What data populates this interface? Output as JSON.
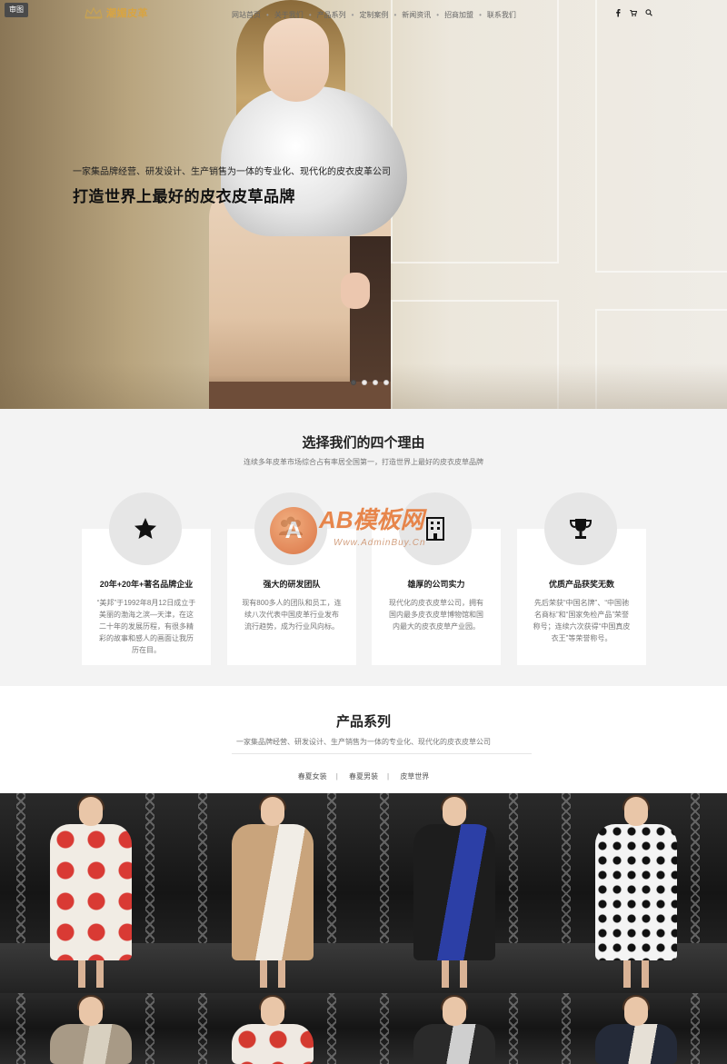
{
  "nav": {
    "home_badge": "审图",
    "logo_text": "潮媚皮革",
    "menu": [
      "网站首页",
      "关于我们",
      "产品系列",
      "定制案例",
      "新闻资讯",
      "招商加盟",
      "联系我们"
    ],
    "icons": [
      "facebook-icon",
      "cart-icon",
      "search-icon"
    ]
  },
  "hero": {
    "subtitle": "一家集品牌经营、研发设计、生产销售为一体的专业化、现代化的皮衣皮革公司",
    "title": "打造世界上最好的皮衣皮草品牌",
    "slides": 4,
    "active_slide": 1
  },
  "reasons": {
    "title": "选择我们的四个理由",
    "subtitle": "连续多年皮革市场综合占有率居全国第一，打造世界上最好的皮衣皮草品牌",
    "cards": [
      {
        "icon": "star-icon",
        "title": "20年+20年+著名品牌企业",
        "text": "“美邦”于1992年8月12日成立于美丽的渤海之滨—天津，在这二十年的发展历程，有很多精彩的故事和感人的画面让我历历在目。"
      },
      {
        "icon": "team-icon",
        "title": "强大的研发团队",
        "text": "现有800多人的团队和员工，连续八次代表中国皮革行业发布流行趋势，成为行业风向标。"
      },
      {
        "icon": "building-icon",
        "title": "雄厚的公司实力",
        "text": "现代化的皮衣皮草公司，拥有国内最多皮衣皮草博物馆和国内最大的皮衣皮草产业园。"
      },
      {
        "icon": "trophy-icon",
        "title": "优质产品获奖无数",
        "text": "先后荣获“中国名牌”、“中国驰名商标”和“国家免检产品”荣誉称号；连续六次获得“中国真皮衣王”等荣誉称号。"
      }
    ]
  },
  "watermark": {
    "letter": "A",
    "title": "AB模板网",
    "url": "Www.AdminBuy.Cn"
  },
  "products": {
    "title": "产品系列",
    "subtitle": "一家集品牌经营、研发设计、生产销售为一体的专业化、现代化的皮衣皮草公司",
    "tabs": [
      "春夏女装",
      "春夏男装",
      "皮草世界"
    ],
    "tiles": [
      {
        "garment": "red-polka-coat",
        "color": "#f1ece4",
        "accent": "#d93a34"
      },
      {
        "garment": "camel-coat-fur",
        "color": "#c9a47c",
        "accent": "#f1ede6"
      },
      {
        "garment": "black-coat-blue-fur",
        "color": "#1d1d1d",
        "accent": "#2c3fa6"
      },
      {
        "garment": "black-white-print-dress",
        "color": "#f4f4f4",
        "accent": "#111111"
      },
      {
        "garment": "metallic-gown",
        "color": "#a89a86",
        "accent": "#d8d0c0"
      },
      {
        "garment": "red-polka-top",
        "color": "#efe9e2",
        "accent": "#d43a30"
      },
      {
        "garment": "dark-jacket-sunglasses",
        "color": "#2a2a2a",
        "accent": "#cfcfcf"
      },
      {
        "garment": "navy-patterned-coat",
        "color": "#242a38",
        "accent": "#e6e0d6"
      }
    ]
  }
}
